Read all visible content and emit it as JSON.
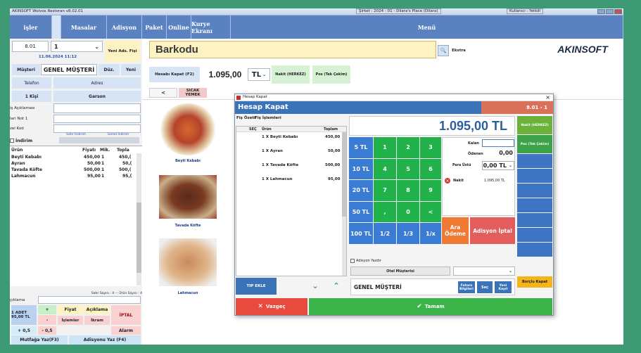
{
  "titlebar": {
    "app": "AKINSOFT Wolvox Restoran v8.02.01",
    "company": "Şirket : 2024 - 01 - Dilara's Place (Dilara)",
    "user": "Kullanıcı : Yetkili"
  },
  "menu": {
    "items": [
      "işler",
      "Masalar",
      "Adisyon",
      "Paket",
      "Online",
      "Kurye Ekranı"
    ],
    "right": "Menü"
  },
  "left": {
    "table": "8.01",
    "qty": "1",
    "new_btn": "Yeni Ads. Fişi",
    "datetime": "11.06.2024 11:12",
    "customer_lbl": "Müşteri",
    "customer": "GENEL MÜŞTERİ",
    "edit_btn": "Düz.",
    "new_cust_btn": "Yeni",
    "phone_lbl": "Telefon",
    "address_lbl": "Adres",
    "person": "1 Kişi",
    "waiter": "Garson",
    "desc_lbl": "iş Açıklaması",
    "note_lbl": "lari Not 1",
    "code_lbl": "zel Kod",
    "row_disc": "Satır İndirim",
    "gen_disc": "Genel İndirim",
    "discount": "İndirim",
    "cols": [
      "Ürün",
      "Fiyatı",
      "Mik.",
      "Topla"
    ],
    "rows": [
      {
        "name": "Beyti Kebabı",
        "price": "450,00",
        "qty": "1",
        "total": "450,("
      },
      {
        "name": "Ayran",
        "price": "50,00",
        "qty": "1",
        "total": "50,("
      },
      {
        "name": "Tavada Köfte",
        "price": "500,00",
        "qty": "1",
        "total": "500,("
      },
      {
        "name": "Lahmacun",
        "price": "95,00",
        "qty": "1",
        "total": "95,("
      }
    ],
    "count_text": "Satır Sayısı : 4  ···  Ürün Sayısı : 4",
    "aciklama": "çıklama",
    "one_adet": "1 ADET 95,00 TL",
    "plus": "+",
    "minus": "-",
    "fiyat": "Fiyat",
    "aciklama_btn": "Açıklama",
    "iptal": "İPTAL",
    "islemler": "İşlemler",
    "ikram": "İkram",
    "p05": "+ 0,5",
    "m05": "- 0,5",
    "alarm": "Alarm",
    "mutfak": "Mutfağa Yaz(F3)",
    "adisyonu": "Adisyonu Yaz (F4)"
  },
  "main": {
    "barkodu": "Barkodu",
    "ekstra": "Ekstra",
    "logo": "AKINSOFT",
    "hesabi": "Hesabı Kapat (F2)",
    "amount": "1.095,00",
    "currency": "TL",
    "nakit": "Nakit (HERKEZ)",
    "pos": "Pos (Tek Çekim)",
    "back": "<",
    "category": "SICAK YEMEK",
    "foods": [
      "Beyti Kebabı",
      "Tavada Köfte",
      "Lahmacun"
    ]
  },
  "dialog": {
    "window_title": "Hesap Kapat",
    "heading": "Hesap Kapat",
    "table": "8.01 - 1",
    "tabs": [
      "Fiş Özeti",
      "Fiş İşlemleri"
    ],
    "cols": [
      "SEÇ",
      "Ürün",
      "Toplam"
    ],
    "items": [
      {
        "name": "1 X Beyti Kebabı",
        "total": "450,00"
      },
      {
        "name": "1 X Ayran",
        "total": "50,00"
      },
      {
        "name": "1 X Tavada Köfte",
        "total": "500,00"
      },
      {
        "name": "1 X Lahmacun",
        "total": "95,00"
      }
    ],
    "big_amount": "1.095,00 TL",
    "keys": [
      "5 TL",
      "1",
      "2",
      "3",
      "10 TL",
      "4",
      "5",
      "6",
      "20 TL",
      "7",
      "8",
      "9",
      "50 TL",
      ",",
      "0",
      "<",
      "100 TL",
      "1/2",
      "1/3",
      "1/x"
    ],
    "kalan": "Kalan",
    "odenen": "Ödenen",
    "odenen_val": "0,00",
    "para_ustu": "Para Üstü",
    "para_val": "0,00",
    "para_cur": "TL",
    "pay_name": "Nakit",
    "pay_amount": "1.095,00 TL",
    "ara_odeme": "Ara Ödeme",
    "adisyon_iptal": "Adisyon İptal",
    "adisyon_yazdir": "Adisyon Yazdır",
    "otel": "Otel Müşterisi",
    "tip_ekle": "TIP EKLE",
    "customer": "GENEL MÜŞTERİ",
    "fatura": "Fatura Bilgileri",
    "sec": "Seç",
    "yeni": "Yeni Kayıt",
    "side": {
      "nakit": "Nakit (HERKEZ)",
      "pos": "Pos (Tek Çekim)",
      "borclu": "Borçlu Kapat"
    },
    "vazgec": "Vazgeç",
    "tamam": "Tamam"
  }
}
